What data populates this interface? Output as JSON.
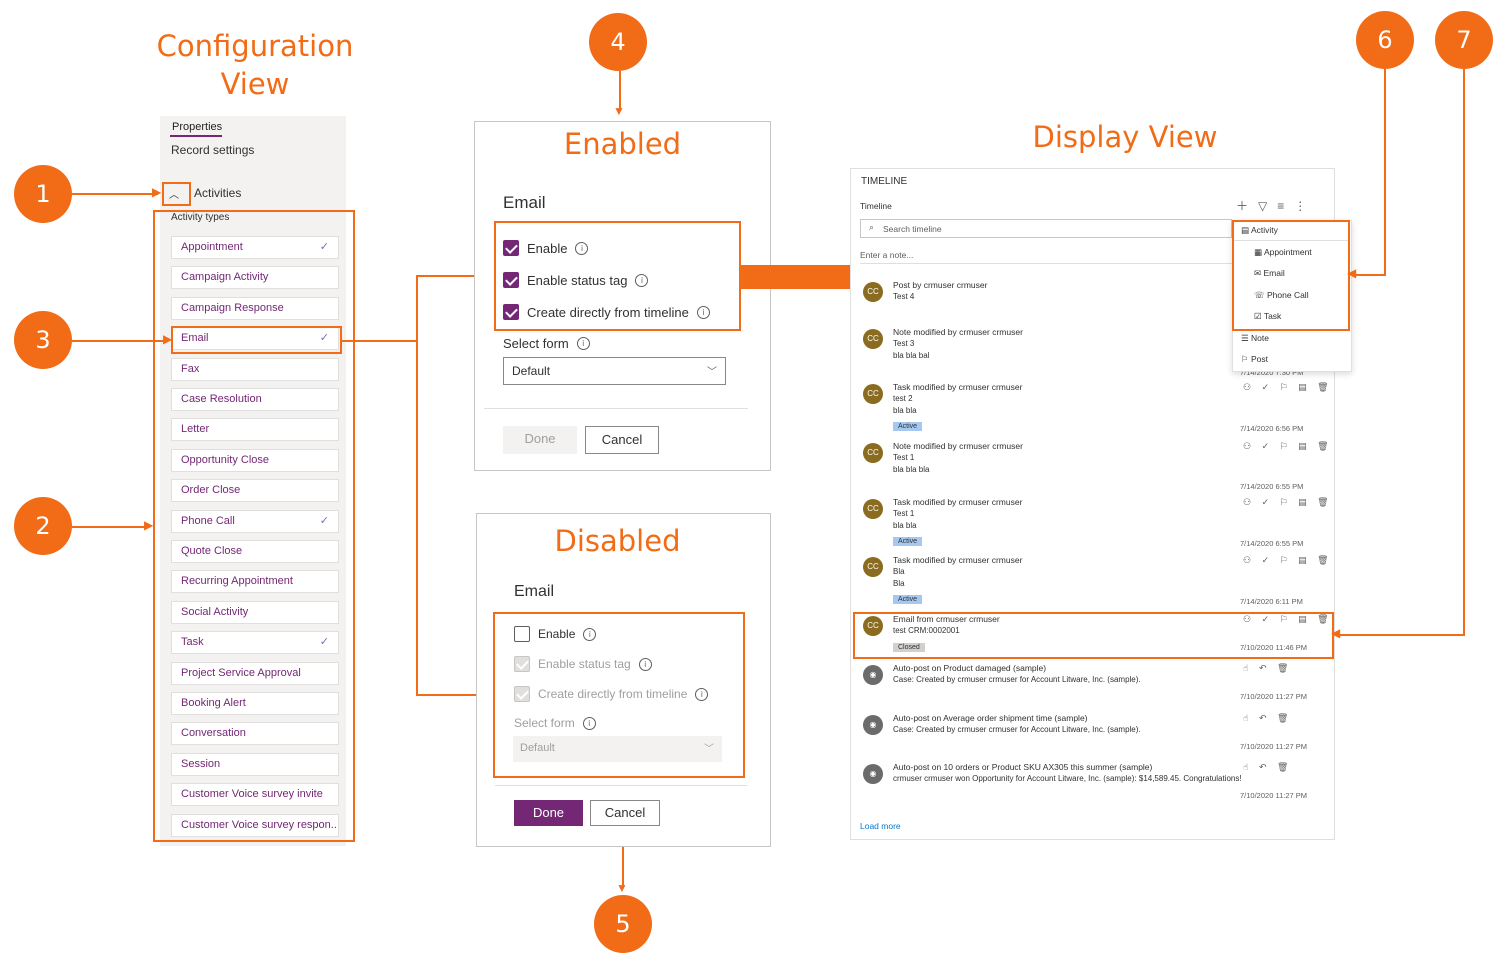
{
  "config_view": {
    "title_line1": "Configuration",
    "title_line2": "View",
    "tab_properties": "Properties",
    "record_settings": "Record settings",
    "section_label": "Activities",
    "activity_types_label": "Activity types",
    "activity_types": [
      {
        "label": "Appointment",
        "checked": "✓"
      },
      {
        "label": "Campaign Activity",
        "checked": ""
      },
      {
        "label": "Campaign Response",
        "checked": ""
      },
      {
        "label": "Email",
        "checked": "✓"
      },
      {
        "label": "Fax",
        "checked": ""
      },
      {
        "label": "Case Resolution",
        "checked": ""
      },
      {
        "label": "Letter",
        "checked": ""
      },
      {
        "label": "Opportunity Close",
        "checked": ""
      },
      {
        "label": "Order Close",
        "checked": ""
      },
      {
        "label": "Phone Call",
        "checked": "✓"
      },
      {
        "label": "Quote Close",
        "checked": ""
      },
      {
        "label": "Recurring Appointment",
        "checked": ""
      },
      {
        "label": "Social Activity",
        "checked": ""
      },
      {
        "label": "Task",
        "checked": "✓"
      },
      {
        "label": "Project Service Approval",
        "checked": ""
      },
      {
        "label": "Booking Alert",
        "checked": ""
      },
      {
        "label": "Conversation",
        "checked": ""
      },
      {
        "label": "Session",
        "checked": ""
      },
      {
        "label": "Customer Voice survey invite",
        "checked": ""
      },
      {
        "label": "Customer Voice survey respon..",
        "checked": ""
      }
    ]
  },
  "callouts": [
    "1",
    "2",
    "3",
    "4",
    "5",
    "6",
    "7"
  ],
  "enabled_dialog": {
    "title": "Enabled",
    "heading": "Email",
    "opt_enable": "Enable",
    "opt_status_tag": "Enable status tag",
    "opt_create": "Create directly from timeline",
    "select_form_label": "Select form",
    "select_form_value": "Default",
    "done": "Done",
    "cancel": "Cancel"
  },
  "disabled_dialog": {
    "title": "Disabled",
    "heading": "Email",
    "opt_enable": "Enable",
    "opt_status_tag": "Enable status tag",
    "opt_create": "Create directly from timeline",
    "select_form_label": "Select form",
    "select_form_value": "Default",
    "done": "Done",
    "cancel": "Cancel"
  },
  "display_view": {
    "title": "Display View",
    "timeline_header": "TIMELINE",
    "timeline_label": "Timeline",
    "search_placeholder": "Search timeline",
    "note_placeholder": "Enter a note...",
    "load_more": "Load more",
    "menu": {
      "activity": "Activity",
      "appointment": "Appointment",
      "email": "Email",
      "phone_call": "Phone Call",
      "task": "Task",
      "note": "Note",
      "post": "Post"
    },
    "entries": [
      {
        "title": "Post by crmuser crmuser",
        "line1": "Test 4",
        "line2": "",
        "status": "",
        "date": "",
        "avatar": "CC"
      },
      {
        "title": "Note modified by crmuser crmuser",
        "line1": "Test 3",
        "line2": "bla bla bal",
        "status": "",
        "date": "7/14/2020 7:30 PM",
        "avatar": "CC"
      },
      {
        "title": "Task modified by crmuser crmuser",
        "line1": "test 2",
        "line2": "bla bla",
        "status": "Active",
        "date": "7/14/2020 6:56 PM",
        "avatar": "CC"
      },
      {
        "title": "Note modified by crmuser crmuser",
        "line1": "Test 1",
        "line2": "bla bla bla",
        "status": "",
        "date": "7/14/2020 6:55 PM",
        "avatar": "CC"
      },
      {
        "title": "Task modified by crmuser crmuser",
        "line1": "Test 1",
        "line2": "bla bla",
        "status": "Active",
        "date": "7/14/2020 6:55 PM",
        "avatar": "CC"
      },
      {
        "title": "Task modified by crmuser crmuser",
        "line1": "Bla",
        "line2": "Bla",
        "status": "Active",
        "date": "7/14/2020 6:11 PM",
        "avatar": "CC"
      },
      {
        "title": "Email from crmuser crmuser",
        "line1": "test CRM:0002001",
        "line2": "",
        "status": "Closed",
        "date": "7/10/2020 11:46 PM",
        "avatar": "CC"
      },
      {
        "title": "Auto-post on Product damaged (sample)",
        "line1": "Case: Created by crmuser crmuser for Account Litware, Inc. (sample).",
        "line2": "",
        "status": "",
        "date": "7/10/2020 11:27 PM",
        "avatar": ""
      },
      {
        "title": "Auto-post on Average order shipment time (sample)",
        "line1": "Case: Created by crmuser crmuser for Account Litware, Inc. (sample).",
        "line2": "",
        "status": "",
        "date": "7/10/2020 11:27 PM",
        "avatar": ""
      },
      {
        "title": "Auto-post on 10 orders or Product SKU AX305 this summer (sample)",
        "line1": "crmuser crmuser won Opportunity for Account Litware, Inc. (sample): $14,589.45. Congratulations!",
        "line2": "",
        "status": "",
        "date": "7/10/2020 11:27 PM",
        "avatar": ""
      }
    ]
  },
  "colors": {
    "accent": "#f26b16",
    "purple": "#742774",
    "active_badge": "#a4c8f0"
  }
}
